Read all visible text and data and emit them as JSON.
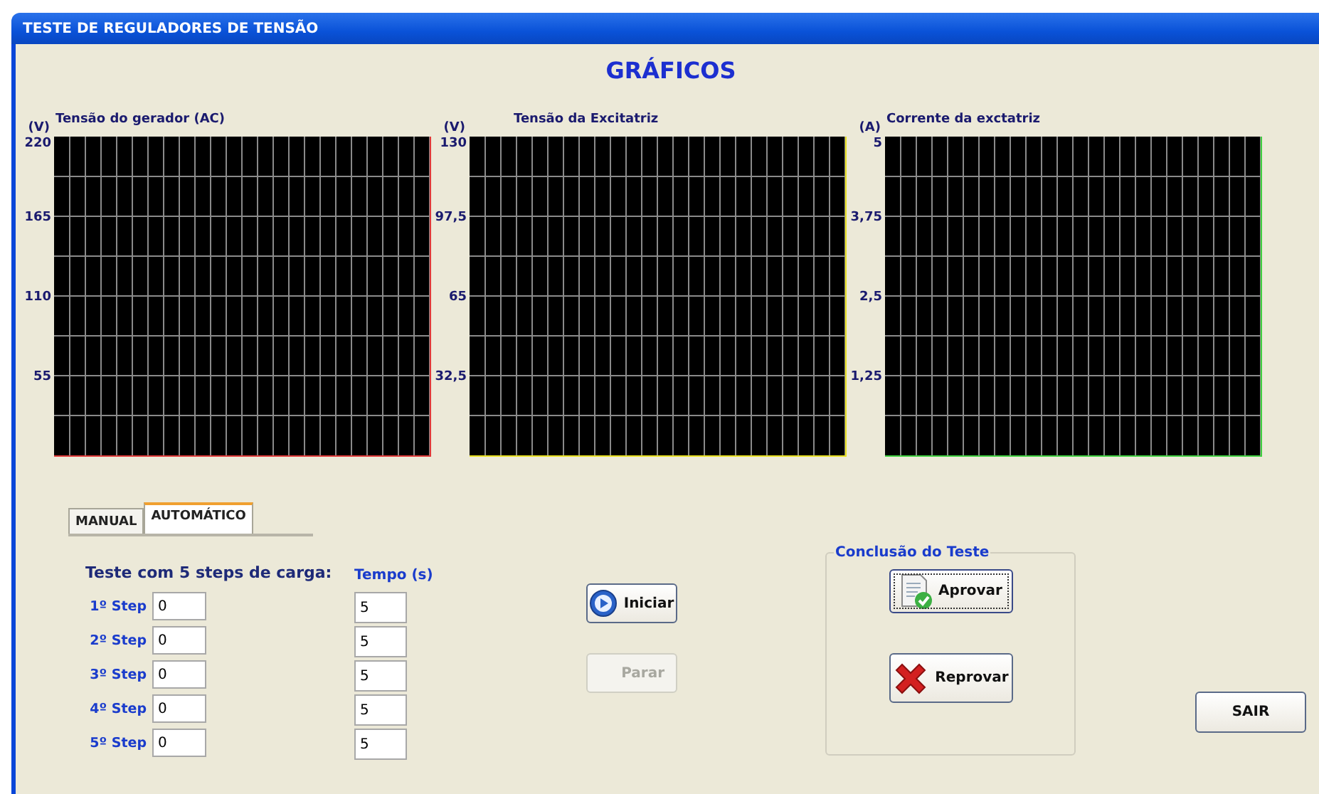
{
  "window": {
    "title": "TESTE DE REGULADORES DE TENSÃO"
  },
  "heading": "GRÁFICOS",
  "graphs": [
    {
      "unit": "(V)",
      "title": "Tensão do gerador (AC)",
      "ticks": [
        "220",
        "165",
        "110",
        "55"
      ],
      "color": "#e03a3a"
    },
    {
      "unit": "(V)",
      "title": "Tensão da Excitatriz",
      "ticks": [
        "130",
        "97,5",
        "65",
        "32,5"
      ],
      "color": "#e8e020"
    },
    {
      "unit": "(A)",
      "title": "Corrente da exctatriz",
      "ticks": [
        "5",
        "3,75",
        "2,5",
        "1,25"
      ],
      "color": "#40d040"
    }
  ],
  "tabs": [
    {
      "label": "MANUAL",
      "selected": false
    },
    {
      "label": "AUTOMÁTICO",
      "selected": true
    }
  ],
  "steps_title": "Teste com 5 steps de carga:",
  "time_title": "Tempo (s)",
  "steps": [
    {
      "label": "1º Step",
      "value": "0",
      "time": "5"
    },
    {
      "label": "2º Step",
      "value": "0",
      "time": "5"
    },
    {
      "label": "3º Step",
      "value": "0",
      "time": "5"
    },
    {
      "label": "4º Step",
      "value": "0",
      "time": "5"
    },
    {
      "label": "5º Step",
      "value": "0",
      "time": "5"
    }
  ],
  "controls": [
    {
      "label": "Iniciar",
      "kind": "start",
      "disabled": false
    },
    {
      "label": "Parar",
      "kind": "stop",
      "disabled": true
    }
  ],
  "conclusion": {
    "title": "Conclusão do Teste",
    "buttons": [
      {
        "label": "Aprovar",
        "kind": "approve",
        "focused": true
      },
      {
        "label": "Reprovar",
        "kind": "reject",
        "focused": false
      }
    ]
  },
  "exit_button": "SAIR"
}
